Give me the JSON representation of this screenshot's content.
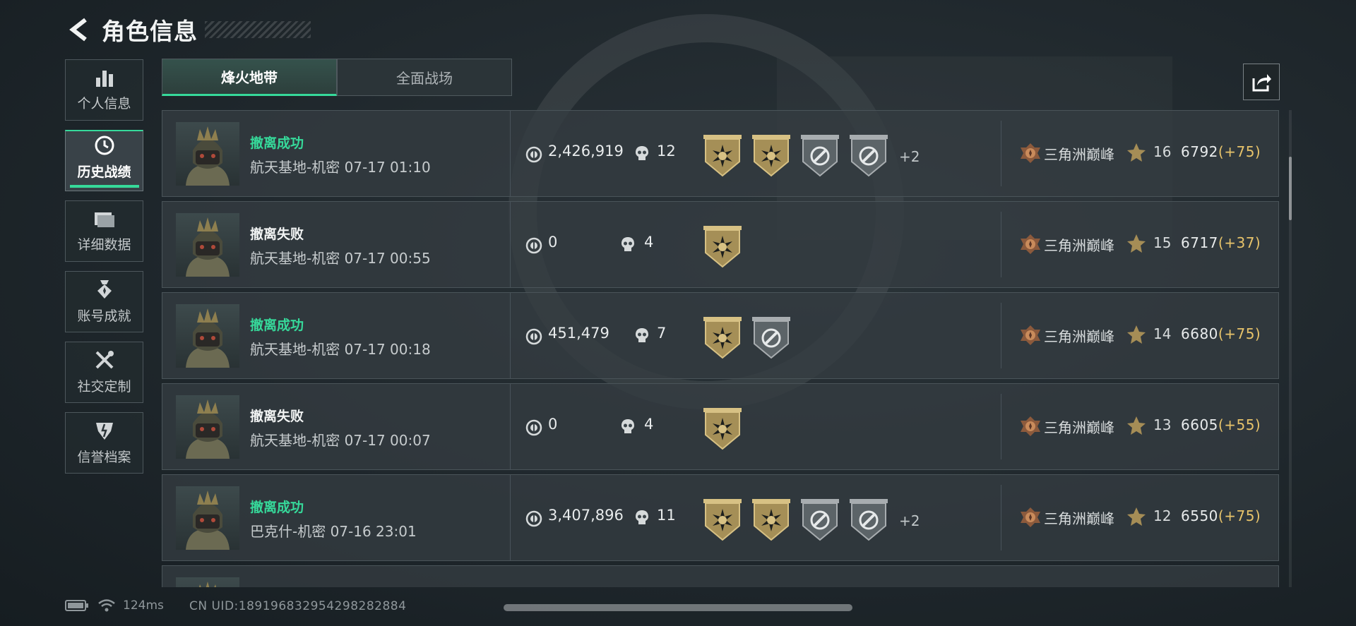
{
  "header": {
    "title": "角色信息"
  },
  "sidebar": {
    "items": [
      {
        "label": "个人信息",
        "icon": "bar-chart-icon",
        "active": false
      },
      {
        "label": "历史战绩",
        "icon": "clock-icon",
        "active": true
      },
      {
        "label": "详细数据",
        "icon": "folder-icon",
        "active": false
      },
      {
        "label": "账号成就",
        "icon": "medal-icon",
        "active": false
      },
      {
        "label": "社交定制",
        "icon": "tools-icon",
        "active": false
      },
      {
        "label": "信誉档案",
        "icon": "shield-icon",
        "active": false
      }
    ]
  },
  "tabs": [
    {
      "label": "烽火地带",
      "active": true
    },
    {
      "label": "全面战场",
      "active": false
    }
  ],
  "records": [
    {
      "status": "撤离成功",
      "success": true,
      "location": "航天基地-机密 07-17 01:10",
      "money": "2,426,919",
      "kills": "12",
      "badges": [
        "gold",
        "gold",
        "gray",
        "gray"
      ],
      "more": "+2",
      "rank": "三角洲巅峰",
      "level": "16",
      "score": "6792",
      "delta": "(+75)"
    },
    {
      "status": "撤离失败",
      "success": false,
      "location": "航天基地-机密 07-17 00:55",
      "money": "0",
      "kills": "4",
      "badges": [
        "gold"
      ],
      "more": "",
      "rank": "三角洲巅峰",
      "level": "15",
      "score": "6717",
      "delta": "(+37)"
    },
    {
      "status": "撤离成功",
      "success": true,
      "location": "航天基地-机密 07-17 00:18",
      "money": "451,479",
      "kills": "7",
      "badges": [
        "gold",
        "gray"
      ],
      "more": "",
      "rank": "三角洲巅峰",
      "level": "14",
      "score": "6680",
      "delta": "(+75)"
    },
    {
      "status": "撤离失败",
      "success": false,
      "location": "航天基地-机密 07-17 00:07",
      "money": "0",
      "kills": "4",
      "badges": [
        "gold"
      ],
      "more": "",
      "rank": "三角洲巅峰",
      "level": "13",
      "score": "6605",
      "delta": "(+55)"
    },
    {
      "status": "撤离成功",
      "success": true,
      "location": "巴克什-机密 07-16 23:01",
      "money": "3,407,896",
      "kills": "11",
      "badges": [
        "gold",
        "gold",
        "gray",
        "gray"
      ],
      "more": "+2",
      "rank": "三角洲巅峰",
      "level": "12",
      "score": "6550",
      "delta": "(+75)"
    }
  ],
  "status_bar": {
    "ping": "124ms",
    "uid": "CN UID:1891968329542982828​84"
  },
  "colors": {
    "accent": "#36d99a",
    "gold": "#e7c36a",
    "bg": "#1f272c"
  }
}
